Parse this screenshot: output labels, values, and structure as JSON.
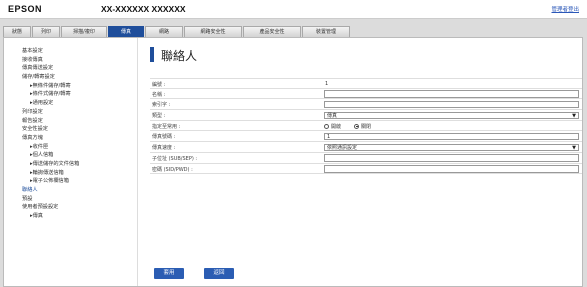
{
  "header": {
    "brand": "EPSON",
    "model": "XX-XXXXXX XXXXXX",
    "admin_link": "管理者登出"
  },
  "tabs": [
    {
      "label": "狀態"
    },
    {
      "label": "列印"
    },
    {
      "label": "掃描/複印"
    },
    {
      "label": "傳真"
    },
    {
      "label": "網路"
    },
    {
      "label": "網路安全性"
    },
    {
      "label": "產品安全性"
    },
    {
      "label": "裝置管理"
    }
  ],
  "active_tab": "傳真",
  "sidebar": {
    "items": [
      {
        "label": "基本設定"
      },
      {
        "label": "接收傳真"
      },
      {
        "label": "傳真傳送設定"
      },
      {
        "label": "儲存/轉寄設定"
      },
      {
        "label": "▸無條件儲存/轉寄"
      },
      {
        "label": "▸條件式儲存/轉寄"
      },
      {
        "label": "▸通用設定"
      },
      {
        "label": "列印設定"
      },
      {
        "label": "報告設定"
      },
      {
        "label": "安全性設定"
      },
      {
        "label": "傳真方塊"
      },
      {
        "label": "▸收件匣"
      },
      {
        "label": "▸個人信箱"
      },
      {
        "label": "▸傳送儲存的文件信箱"
      },
      {
        "label": "▸輪詢傳送信箱"
      },
      {
        "label": "▸電子公佈欄信箱"
      },
      {
        "label": "聯絡人"
      },
      {
        "label": "預設"
      },
      {
        "label": "使用者預設設定"
      },
      {
        "label": "▸傳真"
      }
    ]
  },
  "main": {
    "title": "聯絡人",
    "fields": {
      "number_label": "編號 :",
      "number_value": "1",
      "name_label": "名稱 :",
      "name_value": "",
      "index_label": "索引字 :",
      "index_value": "",
      "type_label": "類型 :",
      "type_value": "傳真",
      "freq_label": "指定至常用 :",
      "freq_off": "開啟",
      "freq_on": "關閉",
      "fax_label": "傳真號碼 :",
      "fax_value": "1",
      "speed_label": "傳真速度 :",
      "speed_value": "依照通訊設定",
      "sub_label": "子位址 (SUB/SEP) :",
      "sub_value": "",
      "pwd_label": "密碼 (SID/PWD) :",
      "pwd_value": ""
    },
    "buttons": {
      "apply": "套用",
      "back": "返回"
    }
  },
  "colors": {
    "accent": "#1f4e9b",
    "button": "#2b5db3",
    "link": "#2a57b8"
  }
}
